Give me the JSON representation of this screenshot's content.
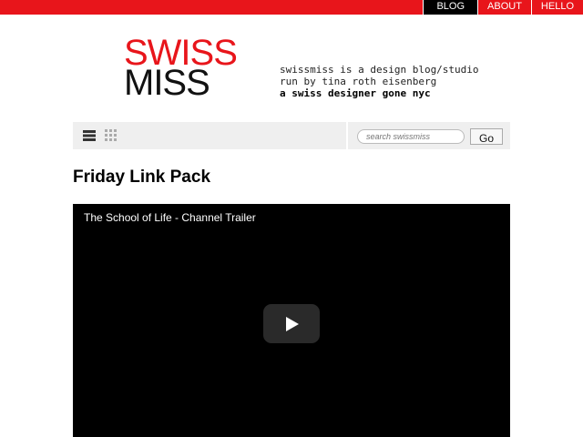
{
  "nav": {
    "items": [
      {
        "label": "BLOG",
        "active": true
      },
      {
        "label": "ABOUT",
        "active": false
      },
      {
        "label": "HELLO",
        "active": false
      }
    ]
  },
  "logo": {
    "line1": "SWISS",
    "line2": "MISS"
  },
  "tagline": {
    "line1": "swissmiss is a design blog/studio",
    "line2": "run by tina roth eisenberg",
    "line3": "a swiss designer gone nyc"
  },
  "toolbar": {
    "list_view_icon": "list-view-icon",
    "grid_view_icon": "grid-view-icon"
  },
  "search": {
    "placeholder": "search swissmiss",
    "button_label": "Go"
  },
  "post": {
    "title": "Friday Link Pack"
  },
  "video": {
    "title": "The School of Life - Channel Trailer",
    "play_icon": "play-icon"
  },
  "colors": {
    "brand_red": "#e8151b",
    "toolbar_bg": "#efefef"
  }
}
